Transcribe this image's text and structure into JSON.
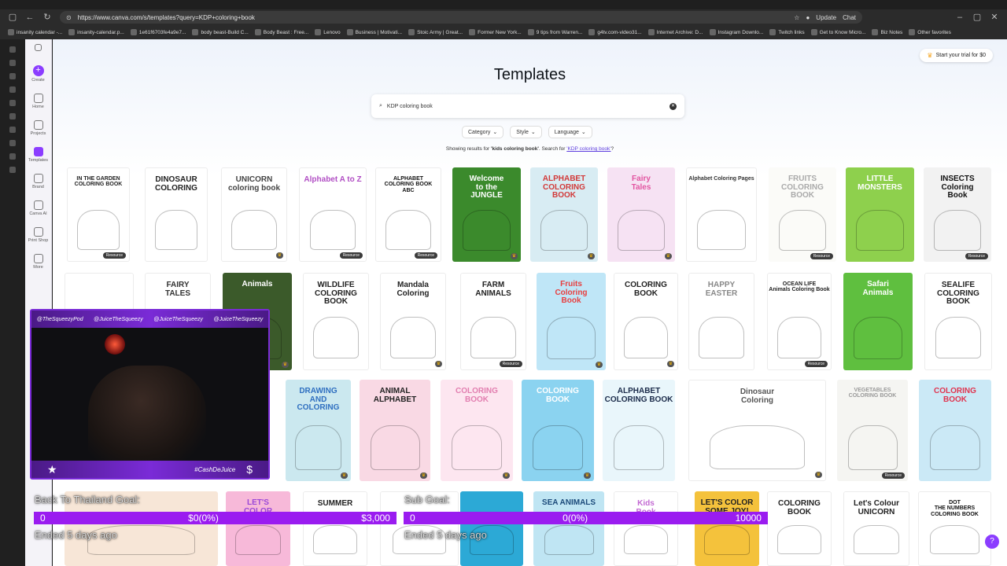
{
  "browser": {
    "url": "https://www.canva.com/s/templates?query=KDP+coloring+book",
    "update_label": "Update",
    "chat_label": "Chat",
    "bookmarks": [
      "insanity calendar -...",
      "insanity-calendar.p...",
      "1e61f6703fe4a9e7...",
      "body beast-Build C...",
      "Body Beast : Free...",
      "Lenovo",
      "Business | Motivati...",
      "Stoic Army | Great...",
      "Former New York...",
      "9 tips from Warren...",
      "g4tv.com-video31...",
      "Internet Archive: D...",
      "Instagram Downlo...",
      "Twitch links",
      "Get to Know Micro...",
      "Biz Notes",
      "Other favorites"
    ]
  },
  "canva_sidebar": [
    {
      "label": "Create",
      "icon": "plus-icon"
    },
    {
      "label": "Home",
      "icon": "home-icon"
    },
    {
      "label": "Projects",
      "icon": "folder-icon"
    },
    {
      "label": "Templates",
      "icon": "templates-icon"
    },
    {
      "label": "Brand",
      "icon": "brand-icon"
    },
    {
      "label": "Canva AI",
      "icon": "ai-icon"
    },
    {
      "label": "Print Shop",
      "icon": "print-icon"
    },
    {
      "label": "More",
      "icon": "more-icon"
    }
  ],
  "header": {
    "trial_label": "Start your trial for $0",
    "title": "Templates"
  },
  "search": {
    "value": "KDP coloring book"
  },
  "filters": [
    "Category",
    "Style",
    "Language"
  ],
  "results": {
    "prefix": "Showing results for",
    "term": "'kids coloring book'",
    "middle": ". Search for",
    "link": "'KDP coloring book'",
    "suffix": "?"
  },
  "badge_label": "Resource",
  "templates": [
    {
      "t": "IN THE GARDEN\nCOLORING BOOK",
      "bg": "#ffffff",
      "fg": "#222",
      "badge": "Resource"
    },
    {
      "t": "DINOSAUR\nCOLORING",
      "bg": "#ffffff",
      "fg": "#222",
      "badge": ""
    },
    {
      "t": "UNICORN\ncoloring book",
      "bg": "#ffffff",
      "fg": "#444",
      "badge": "crown"
    },
    {
      "t": "Alphabet A to Z",
      "bg": "#ffffff",
      "fg": "#b14fc4",
      "badge": "Resource"
    },
    {
      "t": "ALPHABET\nCOLORING BOOK\nABC",
      "bg": "#ffffff",
      "fg": "#111",
      "badge": "Resource"
    },
    {
      "t": "Welcome\nto the\nJUNGLE",
      "bg": "#3b8a2c",
      "fg": "#ffffff",
      "badge": "crown"
    },
    {
      "t": "ALPHABET\nCOLORING\nBOOK",
      "bg": "#d8ecf3",
      "fg": "#d23a3a",
      "badge": "crown"
    },
    {
      "t": "Fairy\nTales",
      "bg": "#f6e2f3",
      "fg": "#e255a1",
      "badge": "crown"
    },
    {
      "t": "Alphabet Coloring Pages",
      "bg": "#ffffff",
      "fg": "#333",
      "badge": ""
    },
    {
      "t": "FRUITS\nCOLORING BOOK",
      "bg": "#fbfbf8",
      "fg": "#aaa",
      "badge": "Resource"
    },
    {
      "t": "LITTLE\nMONSTERS",
      "bg": "#8ed04d",
      "fg": "#ffffff",
      "badge": ""
    },
    {
      "t": "INSECTS\nColoring\nBook",
      "bg": "#f2f2f2",
      "fg": "#111",
      "badge": "Resource"
    },
    {
      "t": "",
      "bg": "#ffffff",
      "fg": "#222",
      "badge": ""
    },
    {
      "t": "FAIRY\nTALES",
      "bg": "#ffffff",
      "fg": "#333",
      "badge": ""
    },
    {
      "t": "Animals",
      "bg": "#3b5a2a",
      "fg": "#ffffff",
      "badge": "crown"
    },
    {
      "t": "WILDLIFE\nCOLORING BOOK",
      "bg": "#ffffff",
      "fg": "#222",
      "badge": ""
    },
    {
      "t": "Mandala Coloring",
      "bg": "#ffffff",
      "fg": "#222",
      "badge": "crown"
    },
    {
      "t": "FARM\nANIMALS",
      "bg": "#ffffff",
      "fg": "#222",
      "badge": "Resource"
    },
    {
      "t": "Fruits\nColoring\nBook",
      "bg": "#bfe6f7",
      "fg": "#e83f3f",
      "badge": "crown"
    },
    {
      "t": "COLORING\nBOOK",
      "bg": "#ffffff",
      "fg": "#222",
      "badge": "crown"
    },
    {
      "t": "HAPPY\nEASTER",
      "bg": "#ffffff",
      "fg": "#888",
      "badge": ""
    },
    {
      "t": "OCEAN LIFE\nAnimals Coloring Book",
      "bg": "#ffffff",
      "fg": "#222",
      "badge": "Resource"
    },
    {
      "t": "Safari\nAnimals",
      "bg": "#5fbf3f",
      "fg": "#ffffff",
      "badge": ""
    },
    {
      "t": "SEALIFE\nCOLORING BOOK",
      "bg": "#ffffff",
      "fg": "#222",
      "badge": ""
    },
    {
      "t": "DRAWING\nAND\nCOLORING",
      "bg": "#cbe8ef",
      "fg": "#2f6fc0",
      "badge": "crown"
    },
    {
      "t": "ANIMAL\nALPHABET",
      "bg": "#f9d9e4",
      "fg": "#222",
      "badge": "crown"
    },
    {
      "t": "COLORING\nBOOK",
      "bg": "#fde6f0",
      "fg": "#e27fb0",
      "badge": "crown"
    },
    {
      "t": "COLORING\nBOOK",
      "bg": "#8bd3f0",
      "fg": "#ffffff",
      "badge": "crown"
    },
    {
      "t": "ALPHABET\nCOLORING BOOK",
      "bg": "#e9f6fb",
      "fg": "#1b2b4a",
      "badge": ""
    },
    {
      "t": "Dinosaur\nColoring",
      "bg": "#ffffff",
      "fg": "#555",
      "badge": "crown"
    },
    {
      "t": "VEGETABLES\nCOLORING BOOK",
      "bg": "#f5f5f2",
      "fg": "#999",
      "badge": "Resource"
    },
    {
      "t": "COLORING\nBOOK",
      "bg": "#cbe9f6",
      "fg": "#e0344f",
      "badge": ""
    },
    {
      "t": "",
      "bg": "#f7e6d7",
      "fg": "#222",
      "badge": ""
    },
    {
      "t": "LET'S\nCOLOR",
      "bg": "#f7b9d9",
      "fg": "#9b47d8",
      "badge": ""
    },
    {
      "t": "SUMMER",
      "bg": "#ffffff",
      "fg": "#222",
      "badge": ""
    },
    {
      "t": "",
      "bg": "#ffffff",
      "fg": "#222",
      "badge": ""
    },
    {
      "t": "",
      "bg": "#2ca9d6",
      "fg": "#ffffff",
      "badge": ""
    },
    {
      "t": "SEA ANIMALS",
      "bg": "#bfe5f3",
      "fg": "#1b4a7a",
      "badge": ""
    },
    {
      "t": "Kids\nBook",
      "bg": "#ffffff",
      "fg": "#c36ad3",
      "badge": ""
    },
    {
      "t": "LET'S COLOR\nSOME JOY!",
      "bg": "#f4c23c",
      "fg": "#222",
      "badge": ""
    },
    {
      "t": "COLORING BOOK",
      "bg": "#ffffff",
      "fg": "#222",
      "badge": ""
    },
    {
      "t": "Let's Colour\nUNICORN",
      "bg": "#ffffff",
      "fg": "#222",
      "badge": ""
    },
    {
      "t": "DOT\nTHE NUMBERS\nCOLORING BOOK",
      "bg": "#ffffff",
      "fg": "#111",
      "badge": ""
    }
  ],
  "stream": {
    "handles": [
      "@TheSqueezyPod",
      "@JuiceTheSqueezy",
      "@JuiceTheSqueezy",
      "@JuiceTheSqueezy"
    ],
    "cashtag": "#CashDeJuice",
    "dollar": "$",
    "goal1": {
      "label": "Back To Thailand Goal:",
      "start": "0",
      "current": "$0(0%)",
      "target": "$3,000",
      "ended": "Ended 5 days ago"
    },
    "goal2": {
      "label": "Sub Goal:",
      "start": "0",
      "current": "0(0%)",
      "target": "10000",
      "ended": "Ended 5 days ago"
    }
  },
  "help_label": "?"
}
